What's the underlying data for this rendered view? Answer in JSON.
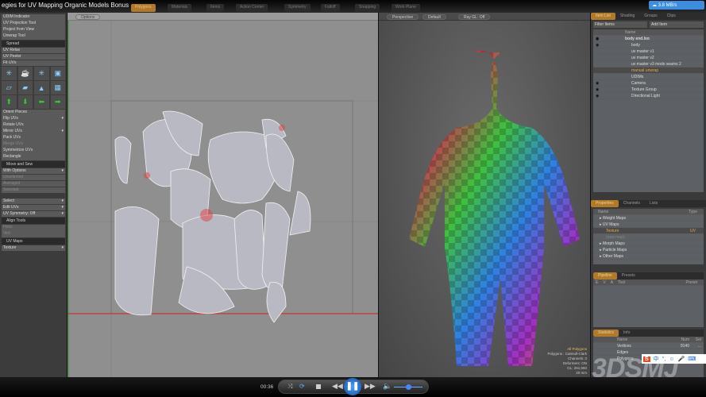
{
  "window": {
    "title": "egies for UV Mapping Organic Models Bonus",
    "speed": "3.8 MB/s"
  },
  "toolbar": [
    "Polygons",
    "Materials",
    "Items",
    "Action Center",
    "Symmetry",
    "Falloff",
    "Snapping",
    "Work Plane"
  ],
  "left_panel": {
    "top": [
      "UDIM Indicator",
      "UV Projection Tool",
      "Project from View",
      "Unwrap Tool"
    ],
    "spread": "Spread",
    "spread_items": [
      "UV Relax",
      "UV Peeler",
      "Fit UVs"
    ],
    "orient": [
      {
        "l": "Orient Pieces"
      },
      {
        "l": "Flip UVs",
        "d": true
      },
      {
        "l": "Rotate UVs"
      },
      {
        "l": "Mirror UVs",
        "d": true
      },
      {
        "l": "Pack UVs"
      },
      {
        "l": "Merge UVs",
        "dim": true
      },
      {
        "l": "Symmetrize UVs"
      },
      {
        "l": "Rectangle"
      }
    ],
    "move_sew": "Move and Sew",
    "move_items": [
      {
        "l": "With Options",
        "d": true
      },
      {
        "l": "Unselected",
        "dim": true
      },
      {
        "l": "Averaged",
        "dim": true
      },
      {
        "l": "Selected",
        "dim": true
      }
    ],
    "select": [
      {
        "l": "Select",
        "d": true
      },
      {
        "l": "Edit UVs",
        "d": true
      },
      {
        "l": "UV Symmetry: Off",
        "d": true
      }
    ],
    "align": "Align Tools",
    "align_items": [
      "Horiz",
      "Vert"
    ],
    "uvmaps": "UV Maps",
    "uvmap_value": "Texture"
  },
  "uv_viewport": {
    "options": "Options"
  },
  "persp_viewport": {
    "view": "Perspective",
    "shading": "Default",
    "raygl": "Ray GL: Off",
    "info": [
      "All Polygons",
      "Polygons : Catmull-Clark",
      "Channels: 0",
      "Deformers: ON",
      "GL: 261,550",
      "20 mm"
    ]
  },
  "item_list": {
    "tabs": [
      "Item List",
      "Shading",
      "Groups",
      "Clips"
    ],
    "filter": "Filter Items",
    "add": "Add Item",
    "col_name": "Name",
    "items": [
      {
        "l": "body end.lxo",
        "i": 0,
        "b": true
      },
      {
        "l": "body",
        "i": 1
      },
      {
        "l": "uv master v1",
        "i": 1
      },
      {
        "l": "uv master v2",
        "i": 1
      },
      {
        "l": "uv master v3 modo seams 2",
        "i": 1
      },
      {
        "l": "manual unwrap",
        "i": 1,
        "sel": true
      },
      {
        "l": "UDIMs",
        "i": 1
      },
      {
        "l": "Camera",
        "i": 1
      },
      {
        "l": "Texture Group",
        "i": 1
      },
      {
        "l": "Directional Light",
        "i": 1
      }
    ]
  },
  "lists": {
    "tabs": [
      "Properties",
      "Channels",
      "Lists"
    ],
    "col_name": "Name",
    "col_type": "Type",
    "items": [
      {
        "l": "Weight Maps",
        "i": 0
      },
      {
        "l": "UV Maps",
        "i": 0
      },
      {
        "l": "Texture",
        "i": 1,
        "t": "UV",
        "sel": true
      },
      {
        "l": "(new map)",
        "i": 1,
        "dim": true
      },
      {
        "l": "Morph Maps",
        "i": 0
      },
      {
        "l": "Particle Maps",
        "i": 0
      },
      {
        "l": "Other Maps",
        "i": 0
      }
    ]
  },
  "pipeline": {
    "tabs": [
      "Pipeline",
      "Presets"
    ],
    "cols": [
      "E",
      "V",
      "A",
      "Tool",
      "Preset"
    ]
  },
  "statistics": {
    "tabs": [
      "Statistics",
      "Info"
    ],
    "cols": [
      "Name",
      "Num",
      "Sel"
    ],
    "rows": [
      {
        "l": "Vertices",
        "n": "9140",
        "s": "..."
      },
      {
        "l": "Edges",
        "n": "",
        "s": ""
      },
      {
        "l": "Polygons",
        "n": "",
        "s": ""
      }
    ]
  },
  "player": {
    "time": "00:36"
  },
  "watermark": "3DSMJ",
  "ime": {
    "lang": "中",
    "punct": "°,"
  },
  "colors": {
    "accent": "#b07a2a",
    "uv_bg": "#8f8f8f",
    "speed_badge": "#3b8de0"
  }
}
